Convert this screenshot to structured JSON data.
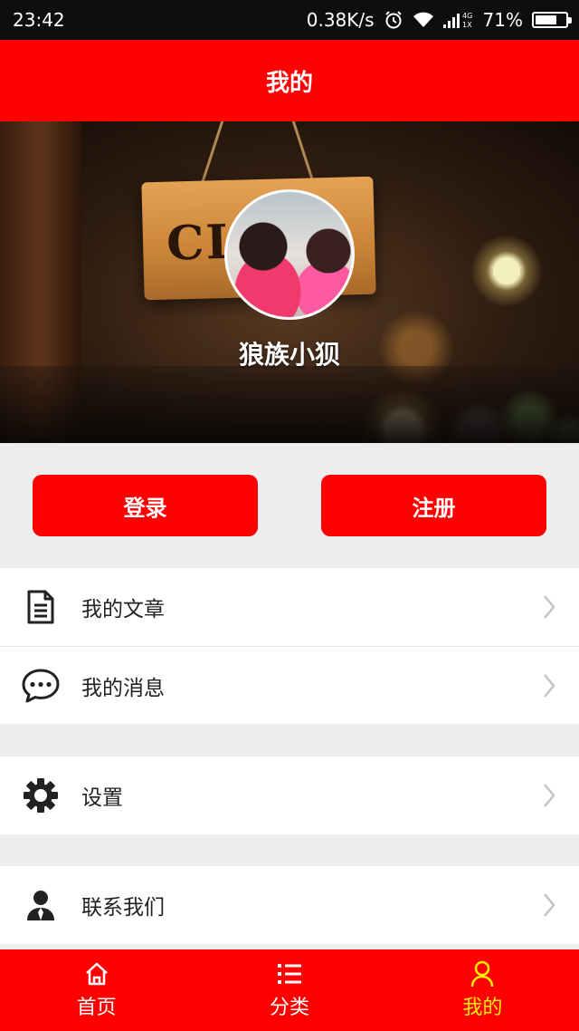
{
  "status_bar": {
    "time": "23:42",
    "network_speed": "0.38K/s",
    "battery_percent": "71%",
    "battery_level": 0.71,
    "icons": [
      "alarm-icon",
      "wifi-icon",
      "signal-icon",
      "battery-icon"
    ]
  },
  "header": {
    "title": "我的"
  },
  "profile": {
    "name": "狼族小狈",
    "sign_text": "CL"
  },
  "auth": {
    "login_label": "登录",
    "register_label": "注册"
  },
  "menu": {
    "articles": {
      "label": "我的文章",
      "icon": "document-icon"
    },
    "messages": {
      "label": "我的消息",
      "icon": "chat-icon"
    },
    "settings": {
      "label": "设置",
      "icon": "gear-icon"
    },
    "contact": {
      "label": "联系我们",
      "icon": "person-icon"
    }
  },
  "bottom_nav": {
    "home": {
      "label": "首页",
      "icon": "home-icon"
    },
    "category": {
      "label": "分类",
      "icon": "list-icon"
    },
    "mine": {
      "label": "我的",
      "icon": "user-icon",
      "active": true
    }
  },
  "colors": {
    "primary": "#ff0000",
    "active_tab": "#ffef00",
    "background": "#ededed"
  }
}
